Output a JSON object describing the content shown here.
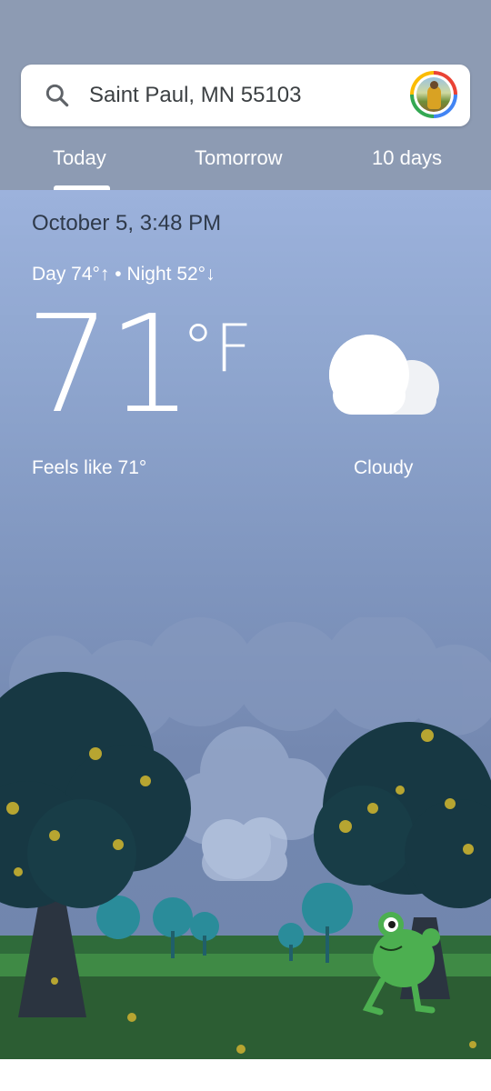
{
  "search": {
    "location": "Saint Paul, MN 55103",
    "icon": "search-icon"
  },
  "account": {
    "icon": "avatar",
    "ring_colors": [
      "#ea4335",
      "#4285f4",
      "#34a853",
      "#fbbc04"
    ]
  },
  "tabs": [
    {
      "label": "Today",
      "selected": true
    },
    {
      "label": "Tomorrow",
      "selected": false
    },
    {
      "label": "10 days",
      "selected": false
    }
  ],
  "weather": {
    "date_time": "October 5, 3:48 PM",
    "day_night": "Day 74°↑ • Night 52°↓",
    "temperature": "71",
    "unit": "°F",
    "feels_like": "Feels like 71°",
    "condition": "Cloudy",
    "condition_icon": "cloud-icon"
  },
  "colors": {
    "header_bg": "#8d9bb3",
    "sky_top": "#9cb2dc",
    "sky_bottom": "#6f85ac",
    "frog": "#4caf50"
  }
}
